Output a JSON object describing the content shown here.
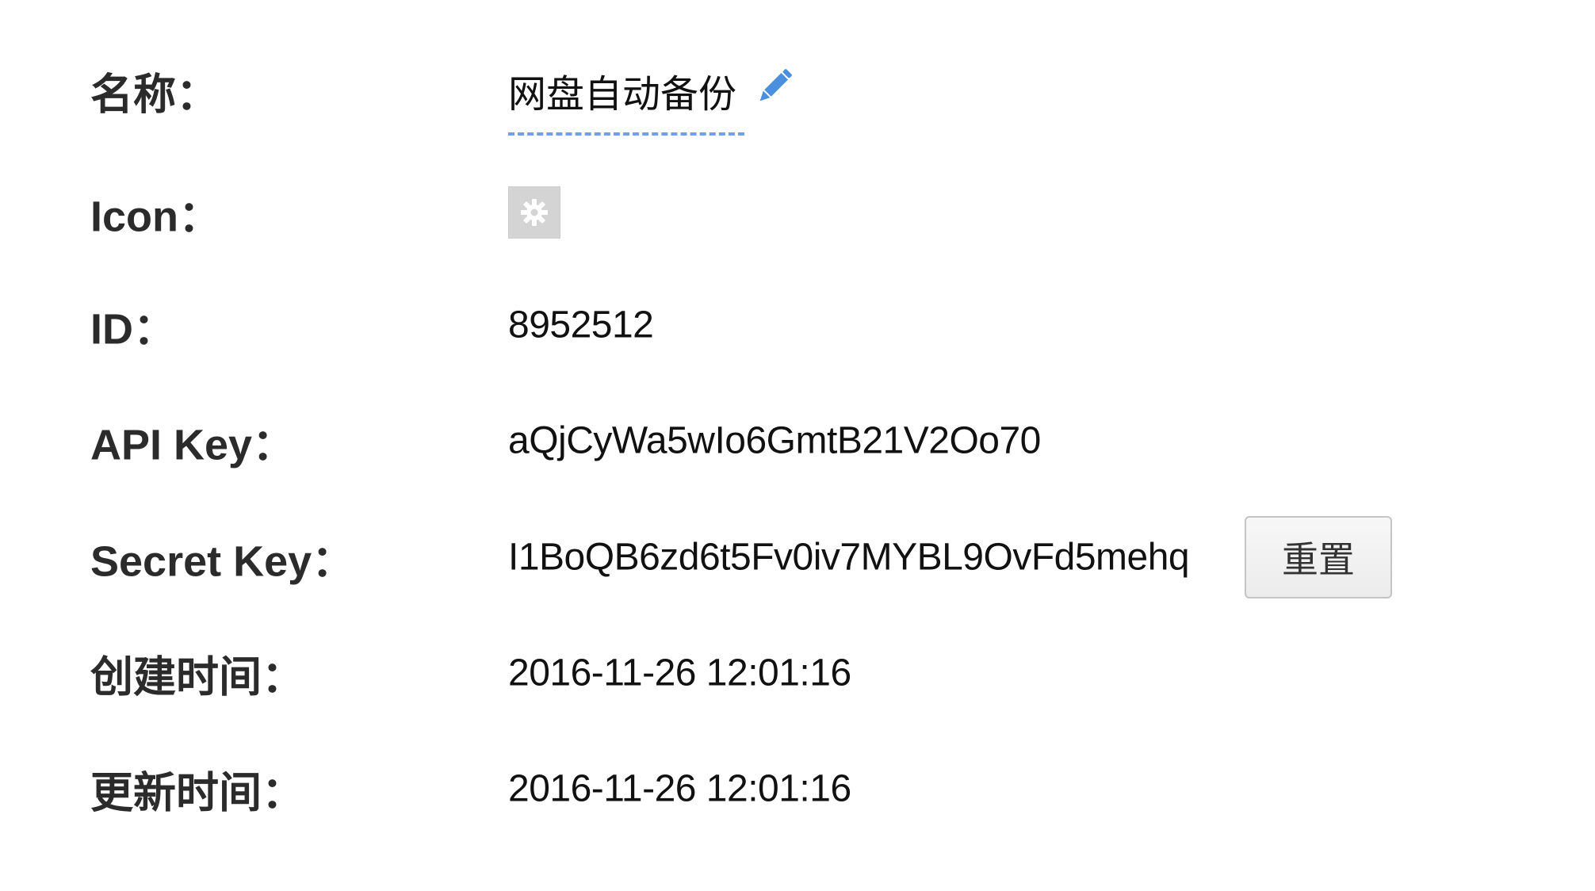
{
  "fields": {
    "name": {
      "label": "名称：",
      "value": "网盘自动备份"
    },
    "icon": {
      "label": "Icon：",
      "icon": "gear-icon"
    },
    "id": {
      "label": "ID：",
      "value": "8952512"
    },
    "api_key": {
      "label": "API Key：",
      "value": "aQjCyWa5wIo6GmtB21V2Oo70"
    },
    "secret_key": {
      "label": "Secret Key：",
      "value": "I1BoQB6zd6t5Fv0iv7MYBL9OvFd5mehq",
      "reset_label": "重置"
    },
    "created": {
      "label": "创建时间：",
      "value": "2016-11-26 12:01:16"
    },
    "updated": {
      "label": "更新时间：",
      "value": "2016-11-26 12:01:16"
    }
  },
  "colors": {
    "edit_icon": "#4a8fe0",
    "name_underline": "#6fa0e8",
    "icon_box": "#d4d4d4"
  }
}
